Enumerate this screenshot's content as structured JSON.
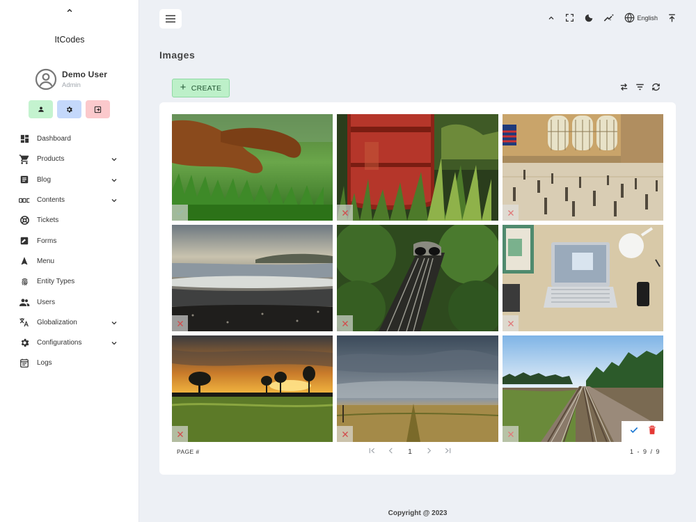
{
  "app": {
    "brand": "ItCodes"
  },
  "user": {
    "name": "Demo User",
    "role": "Admin"
  },
  "quick_actions": [
    {
      "icon": "person-icon",
      "color": "#c4f3cf"
    },
    {
      "icon": "gear-icon",
      "color": "#c4d8fb"
    },
    {
      "icon": "logout-icon",
      "color": "#fbc9cc"
    }
  ],
  "sidebar": {
    "items": [
      {
        "label": "Dashboard",
        "icon": "dashboard-icon",
        "expandable": false
      },
      {
        "label": "Products",
        "icon": "cart-icon",
        "expandable": true
      },
      {
        "label": "Blog",
        "icon": "article-icon",
        "expandable": true
      },
      {
        "label": "Contents",
        "icon": "abc-icon",
        "expandable": true
      },
      {
        "label": "Tickets",
        "icon": "support-icon",
        "expandable": false
      },
      {
        "label": "Forms",
        "icon": "form-icon",
        "expandable": false
      },
      {
        "label": "Menu",
        "icon": "navigation-icon",
        "expandable": false
      },
      {
        "label": "Entity Types",
        "icon": "fingerprint-icon",
        "expandable": false
      },
      {
        "label": "Users",
        "icon": "people-icon",
        "expandable": false
      },
      {
        "label": "Globalization",
        "icon": "translate-icon",
        "expandable": true
      },
      {
        "label": "Configurations",
        "icon": "settings-icon",
        "expandable": true
      },
      {
        "label": "Logs",
        "icon": "calendar-list-icon",
        "expandable": false
      }
    ]
  },
  "header": {
    "icons": [
      "chevron-up-icon",
      "fullscreen-icon",
      "dark-mode-icon",
      "magic-wand-icon",
      "globe-icon",
      "upload-icon"
    ],
    "language": "English"
  },
  "page": {
    "title": "Images"
  },
  "toolbar": {
    "create_label": "CREATE",
    "create_color": "#bdf0c9",
    "actions": [
      "swap-icon",
      "filter-icon",
      "refresh-icon"
    ]
  },
  "gallery": {
    "images": [
      {
        "subject": "dogs-on-grass",
        "selected": true
      },
      {
        "subject": "rusty-barrel",
        "selected": false
      },
      {
        "subject": "train-station-hall",
        "selected": false
      },
      {
        "subject": "beach-waves",
        "selected": false
      },
      {
        "subject": "railway-tunnel",
        "selected": false
      },
      {
        "subject": "laptop-on-desk",
        "selected": false
      },
      {
        "subject": "sunset-field",
        "selected": false
      },
      {
        "subject": "cloudy-meadow",
        "selected": false
      },
      {
        "subject": "railway-tracks",
        "selected": false,
        "hover_actions": [
          "check-icon",
          "delete-icon"
        ]
      }
    ]
  },
  "pagination": {
    "label": "PAGE #",
    "current_page": "1",
    "range": "1 - 9 / 9"
  },
  "footer": {
    "copyright": "Copyright @ 2023"
  },
  "colors": {
    "accent_delete": "#e53935",
    "check": "#1976d2",
    "unselected_mark": "#e06060"
  }
}
